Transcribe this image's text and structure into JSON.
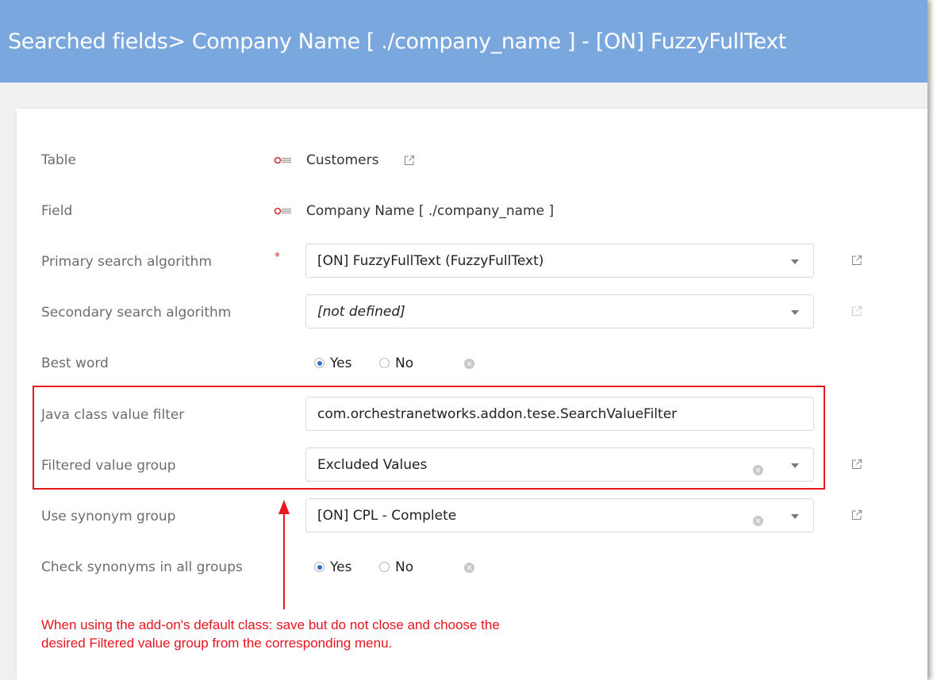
{
  "header": {
    "title": "Searched fields> Company Name [ ./company_name ] - [ON] FuzzyFullText"
  },
  "form": {
    "table": {
      "label": "Table",
      "value": "Customers"
    },
    "field": {
      "label": "Field",
      "value": "Company Name [ ./company_name ]"
    },
    "primary_algorithm": {
      "label": "Primary search algorithm",
      "required_mark": "*",
      "value": "[ON] FuzzyFullText (FuzzyFullText)"
    },
    "secondary_algorithm": {
      "label": "Secondary search algorithm",
      "value": "[not defined]"
    },
    "best_word": {
      "label": "Best word",
      "yes": "Yes",
      "no": "No",
      "selected": "Yes"
    },
    "java_filter": {
      "label": "Java class value filter",
      "value": "com.orchestranetworks.addon.tese.SearchValueFilter"
    },
    "filtered_group": {
      "label": "Filtered value group",
      "value": "Excluded Values"
    },
    "synonym_group": {
      "label": "Use synonym group",
      "value": "[ON] CPL - Complete"
    },
    "check_synonyms": {
      "label": "Check synonyms in all groups",
      "yes": "Yes",
      "no": "No",
      "selected": "Yes"
    }
  },
  "annotation": {
    "line1": "When using the add-on's default class: save but do not close and choose the",
    "line2": "desired Filtered value group from the corresponding menu.",
    "color": "#e8141e"
  },
  "colors": {
    "header": "#7ba7df",
    "accent": "#2f74c9",
    "annotation": "#e8141e"
  }
}
